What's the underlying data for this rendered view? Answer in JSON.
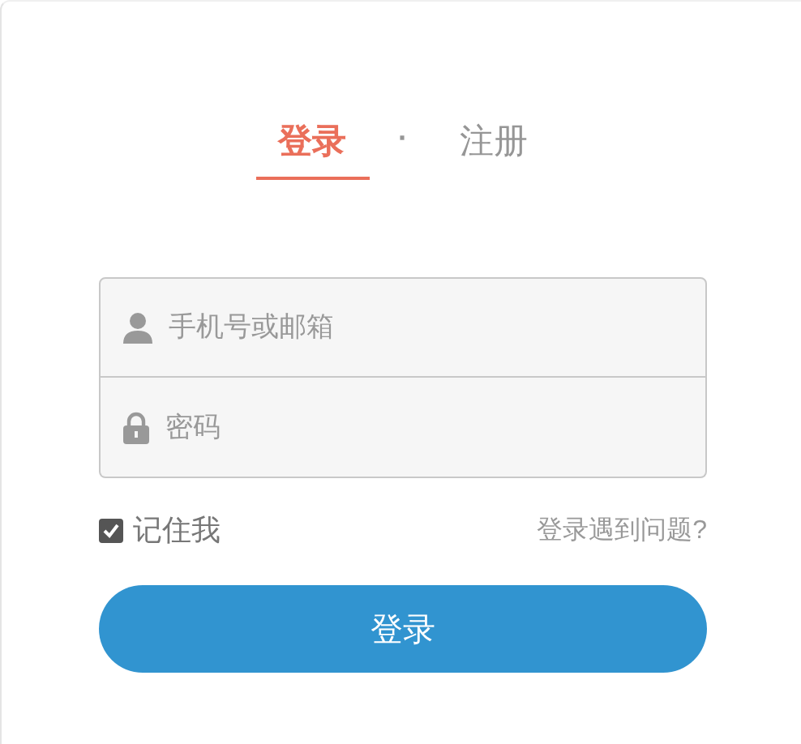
{
  "tabs": [
    {
      "label": "登录",
      "selected": true
    },
    {
      "label": "注册",
      "selected": false
    }
  ],
  "tab_separator": "·",
  "fields": [
    {
      "kind": "user",
      "placeholder": "手机号或邮箱"
    },
    {
      "kind": "password",
      "placeholder": "密码"
    }
  ],
  "remember_me": {
    "label": "记住我",
    "checked": true
  },
  "help_link": "登录遇到问题?",
  "submit_button": "登录"
}
